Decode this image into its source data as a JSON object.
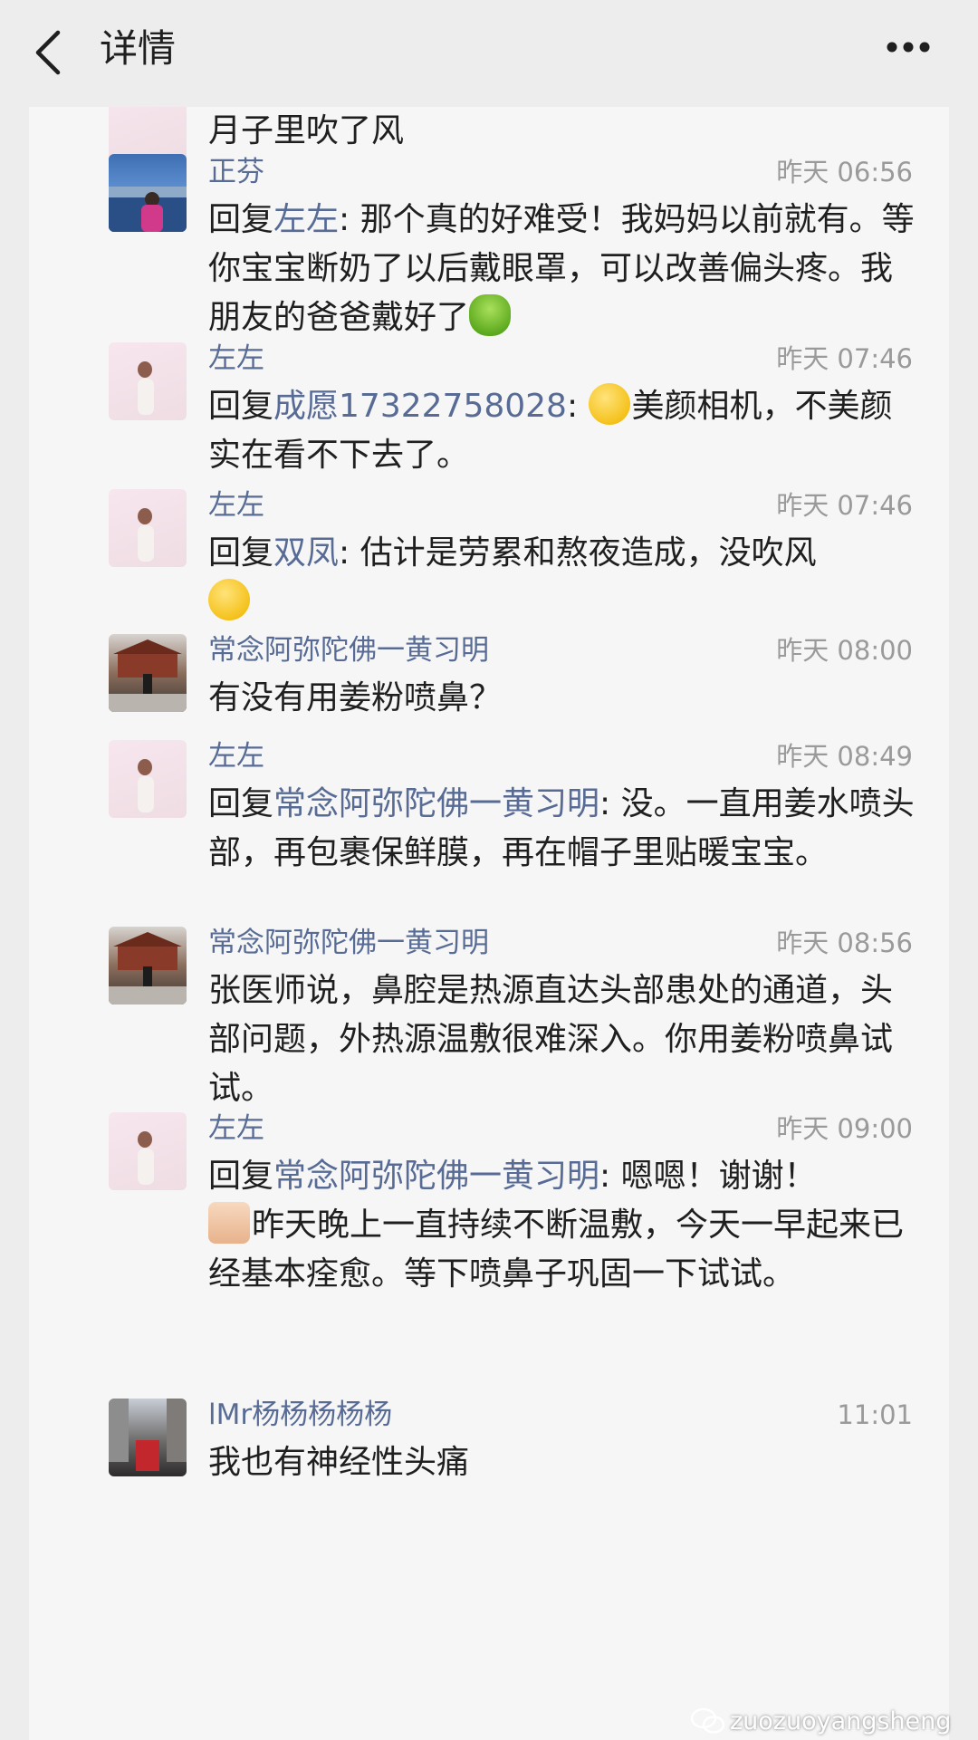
{
  "header": {
    "title": "详情"
  },
  "comments": [
    {
      "name": "",
      "time": "",
      "reply_prefix": "",
      "reply_target": "",
      "text": "月子里吹了风"
    },
    {
      "name": "正芬",
      "time": "昨天 06:56",
      "reply_prefix": "回复",
      "reply_target": "左左",
      "text": ": 那个真的好难受！我妈妈以前就有。等你宝宝断奶了以后戴眼罩，可以改善偏头疼。我朋友的爸爸戴好了",
      "emoji_after": "green-face-emoji"
    },
    {
      "name": "左左",
      "time": "昨天 07:46",
      "reply_prefix": "回复",
      "reply_target": "成愿17322758028",
      "text": "美颜相机，不美颜实在看不下去了。",
      "emoji_before": "facepalm-emoji"
    },
    {
      "name": "左左",
      "time": "昨天 07:46",
      "reply_prefix": "回复",
      "reply_target": "双凤",
      "text": ": 估计是劳累和熬夜造成，没吹风",
      "emoji_after": "facepalm-emoji"
    },
    {
      "name": "常念阿弥陀佛一黄习明",
      "time": "昨天 08:00",
      "reply_prefix": "",
      "reply_target": "",
      "text": "有没有用姜粉喷鼻？"
    },
    {
      "name": "左左",
      "time": "昨天 08:49",
      "reply_prefix": "回复",
      "reply_target": "常念阿弥陀佛一黄习明",
      "text": ": 没。一直用姜水喷头部，再包裹保鲜膜，再在帽子里贴暖宝宝。"
    },
    {
      "name": "常念阿弥陀佛一黄习明",
      "time": "昨天 08:56",
      "reply_prefix": "",
      "reply_target": "",
      "text": "张医师说，鼻腔是热源直达头部患处的通道，头部问题，外热源温敷很难深入。你用姜粉喷鼻试试。"
    },
    {
      "name": "左左",
      "time": "昨天 09:00",
      "reply_prefix": "回复",
      "reply_target": "常念阿弥陀佛一黄习明",
      "text": ": 嗯嗯！谢谢！",
      "text2": "昨天晚上一直持续不断温敷，今天一早起来已经基本痊愈。等下喷鼻子巩固一下试试。",
      "emoji_mid": "praying-hands-emoji"
    },
    {
      "name": "lMr杨杨杨杨杨",
      "time": "11:01",
      "reply_prefix": "",
      "reply_target": "",
      "text": "我也有神经性头痛"
    }
  ],
  "watermark": {
    "text": "zuozuoyangsheng"
  },
  "colors": {
    "link": "#576b95",
    "text": "#1f1f1f",
    "muted": "#9a9a9a",
    "panel": "#f6f6f6",
    "bg": "#ededed"
  }
}
